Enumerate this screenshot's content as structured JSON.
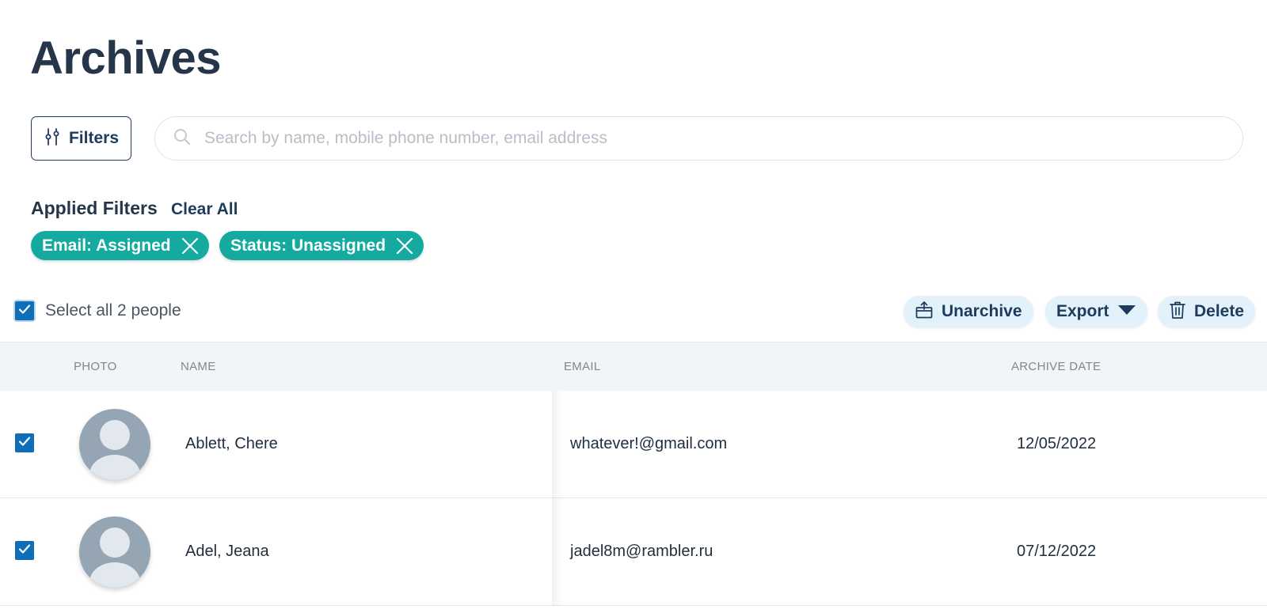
{
  "page": {
    "title": "Archives"
  },
  "toolbar": {
    "filters_label": "Filters",
    "search_placeholder": "Search by name, mobile phone number, email address",
    "search_value": ""
  },
  "applied_filters": {
    "label": "Applied Filters",
    "clear_all": "Clear All",
    "chips": [
      {
        "label": "Email: Assigned"
      },
      {
        "label": "Status: Unassigned"
      }
    ]
  },
  "selection": {
    "select_all_label": "Select all 2 people",
    "select_all_checked": true
  },
  "actions": {
    "unarchive": "Unarchive",
    "export": "Export",
    "delete": "Delete"
  },
  "table": {
    "columns": [
      "PHOTO",
      "NAME",
      "EMAIL",
      "ARCHIVE DATE"
    ],
    "rows": [
      {
        "checked": true,
        "name": "Ablett, Chere",
        "email": "whatever!@gmail.com",
        "archive_date": "12/05/2022"
      },
      {
        "checked": true,
        "name": "Adel, Jeana",
        "email": "jadel8m@rambler.ru",
        "archive_date": "07/12/2022"
      }
    ]
  },
  "colors": {
    "primary_text": "#25364a",
    "accent_navy": "#1f3b5b",
    "chip_teal": "#14aaa0",
    "checkbox_blue": "#0e6fb8",
    "action_bg": "#e3f1fb",
    "header_bg": "#f1f5f8"
  },
  "icons": {
    "filters": "sliders-icon",
    "search": "search-icon",
    "chip_close": "close-icon",
    "unarchive": "unarchive-box-icon",
    "export": "caret-down-icon",
    "delete": "trash-icon",
    "avatar": "user-placeholder-icon"
  }
}
